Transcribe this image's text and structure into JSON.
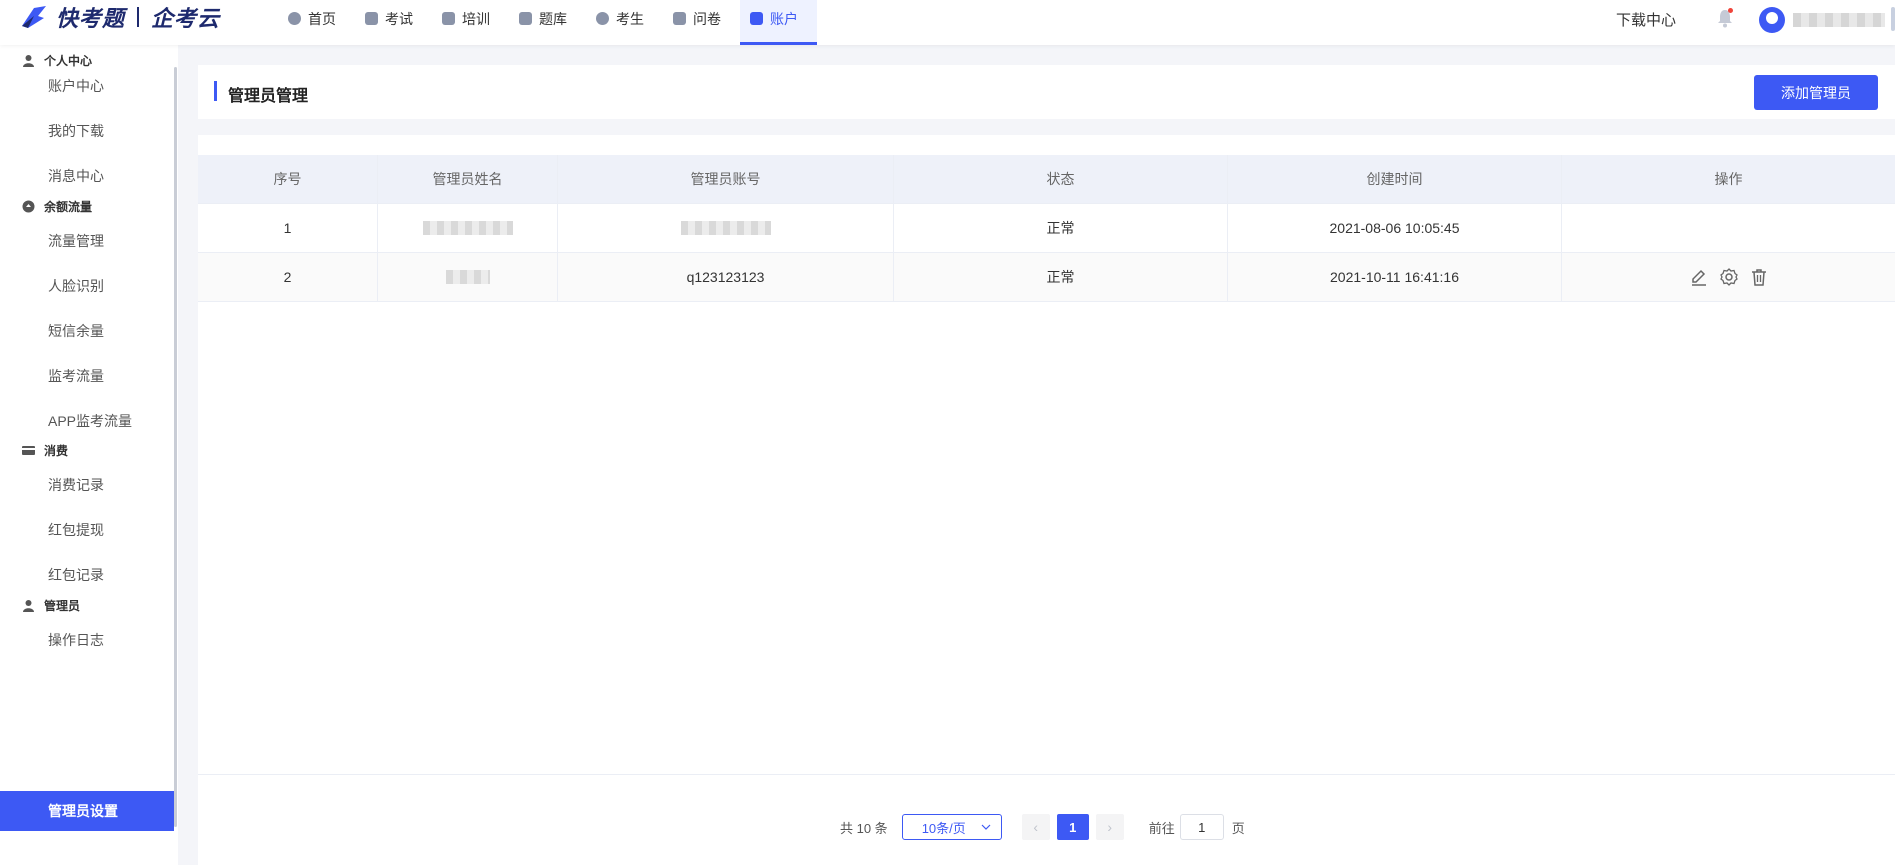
{
  "logo": {
    "brand": "快考题",
    "product": "企考云"
  },
  "nav": [
    {
      "label": "首页",
      "icon": "home-icon",
      "active": false
    },
    {
      "label": "考试",
      "icon": "exam-icon",
      "active": false
    },
    {
      "label": "培训",
      "icon": "training-icon",
      "active": false
    },
    {
      "label": "题库",
      "icon": "question-bank-icon",
      "active": false
    },
    {
      "label": "考生",
      "icon": "examinee-icon",
      "active": false
    },
    {
      "label": "问卷",
      "icon": "survey-icon",
      "active": false
    },
    {
      "label": "账户",
      "icon": "account-icon",
      "active": true
    }
  ],
  "topright": {
    "download_center": "下载中心"
  },
  "sidebar": {
    "groups": [
      {
        "title": "个人中心",
        "icon": "user-icon",
        "items": [
          "账户中心",
          "我的下载",
          "消息中心"
        ]
      },
      {
        "title": "余额流量",
        "icon": "balance-icon",
        "items": [
          "流量管理",
          "人脸识别",
          "短信余量",
          "监考流量",
          "APP监考流量"
        ]
      },
      {
        "title": "消费",
        "icon": "card-icon",
        "items": [
          "消费记录",
          "红包提现",
          "红包记录"
        ]
      },
      {
        "title": "管理员",
        "icon": "admin-icon",
        "items": [
          "操作日志",
          "管理员设置"
        ]
      }
    ],
    "active_item": "管理员设置"
  },
  "page": {
    "title": "管理员管理",
    "add_button": "添加管理员"
  },
  "table": {
    "columns": [
      "序号",
      "管理员姓名",
      "管理员账号",
      "状态",
      "创建时间",
      "操作"
    ],
    "rows": [
      {
        "index": "1",
        "name": "",
        "account": "",
        "status": "正常",
        "created": "2021-08-06 10:05:45"
      },
      {
        "index": "2",
        "name": "",
        "account": "q123123123",
        "status": "正常",
        "created": "2021-10-11 16:41:16"
      }
    ]
  },
  "pagination": {
    "total": "共 10 条",
    "page_size": "10条/页",
    "current_page": "1",
    "goto_label": "前往",
    "goto_value": "1",
    "goto_suffix": "页"
  },
  "colors": {
    "accent": "#3d59f4",
    "header_bg": "#eef1f9",
    "page_bg": "#f4f5f9"
  }
}
